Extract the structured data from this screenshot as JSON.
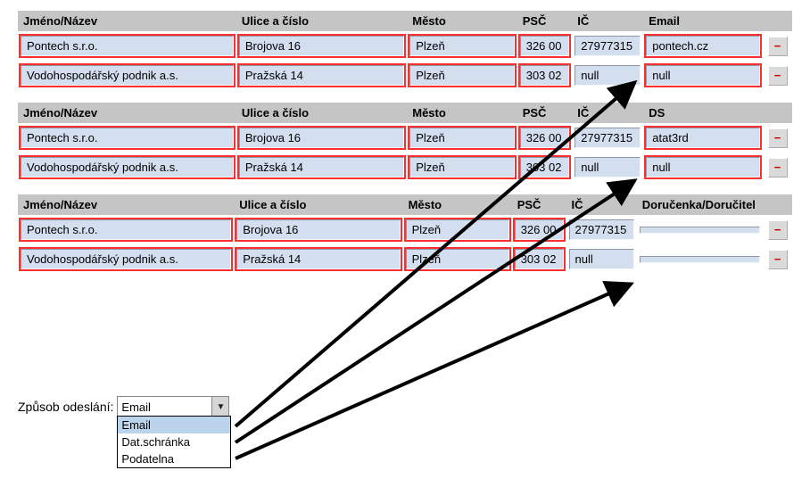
{
  "columns": {
    "name": "Jméno/Název",
    "street": "Ulice a číslo",
    "city": "Město",
    "psc": "PSČ",
    "ic": "IČ"
  },
  "groups": [
    {
      "last_header": "Email",
      "highlight_last": true,
      "rows": [
        {
          "name": "Pontech s.r.o.",
          "street": "Brojova 16",
          "city": "Plzeň",
          "psc": "326 00",
          "ic": "27977315",
          "last": "pontech.cz",
          "hi_ic": false
        },
        {
          "name": "Vodohospodářský podnik a.s.",
          "street": "Pražská 14",
          "city": "Plzeň",
          "psc": "303 02",
          "ic": "null",
          "last": "null",
          "hi_ic": false
        }
      ]
    },
    {
      "last_header": "DS",
      "highlight_last": true,
      "rows": [
        {
          "name": "Pontech s.r.o.",
          "street": "Brojova 16",
          "city": "Plzeň",
          "psc": "326 00",
          "ic": "27977315",
          "last": "atat3rd",
          "hi_ic": false
        },
        {
          "name": "Vodohospodářský podnik a.s.",
          "street": "Pražská 14",
          "city": "Plzeň",
          "psc": "303 02",
          "ic": "null",
          "last": "null",
          "hi_ic": false
        }
      ]
    },
    {
      "last_header": "Doručenka/Doručitel",
      "highlight_last": false,
      "rows": [
        {
          "name": "Pontech s.r.o.",
          "street": "Brojova 16",
          "city": "Plzeň",
          "psc": "326 00",
          "ic": "27977315",
          "last": "",
          "hi_ic": false
        },
        {
          "name": "Vodohospodářský podnik a.s.",
          "street": "Pražská 14",
          "city": "Plzeň",
          "psc": "303 02",
          "ic": "null",
          "last": "",
          "hi_ic": false
        }
      ]
    }
  ],
  "remove_glyph": "−",
  "send": {
    "label": "Způsob odeslání:",
    "value": "Email",
    "options": [
      "Email",
      "Dat.schránka",
      "Podatelna"
    ]
  }
}
